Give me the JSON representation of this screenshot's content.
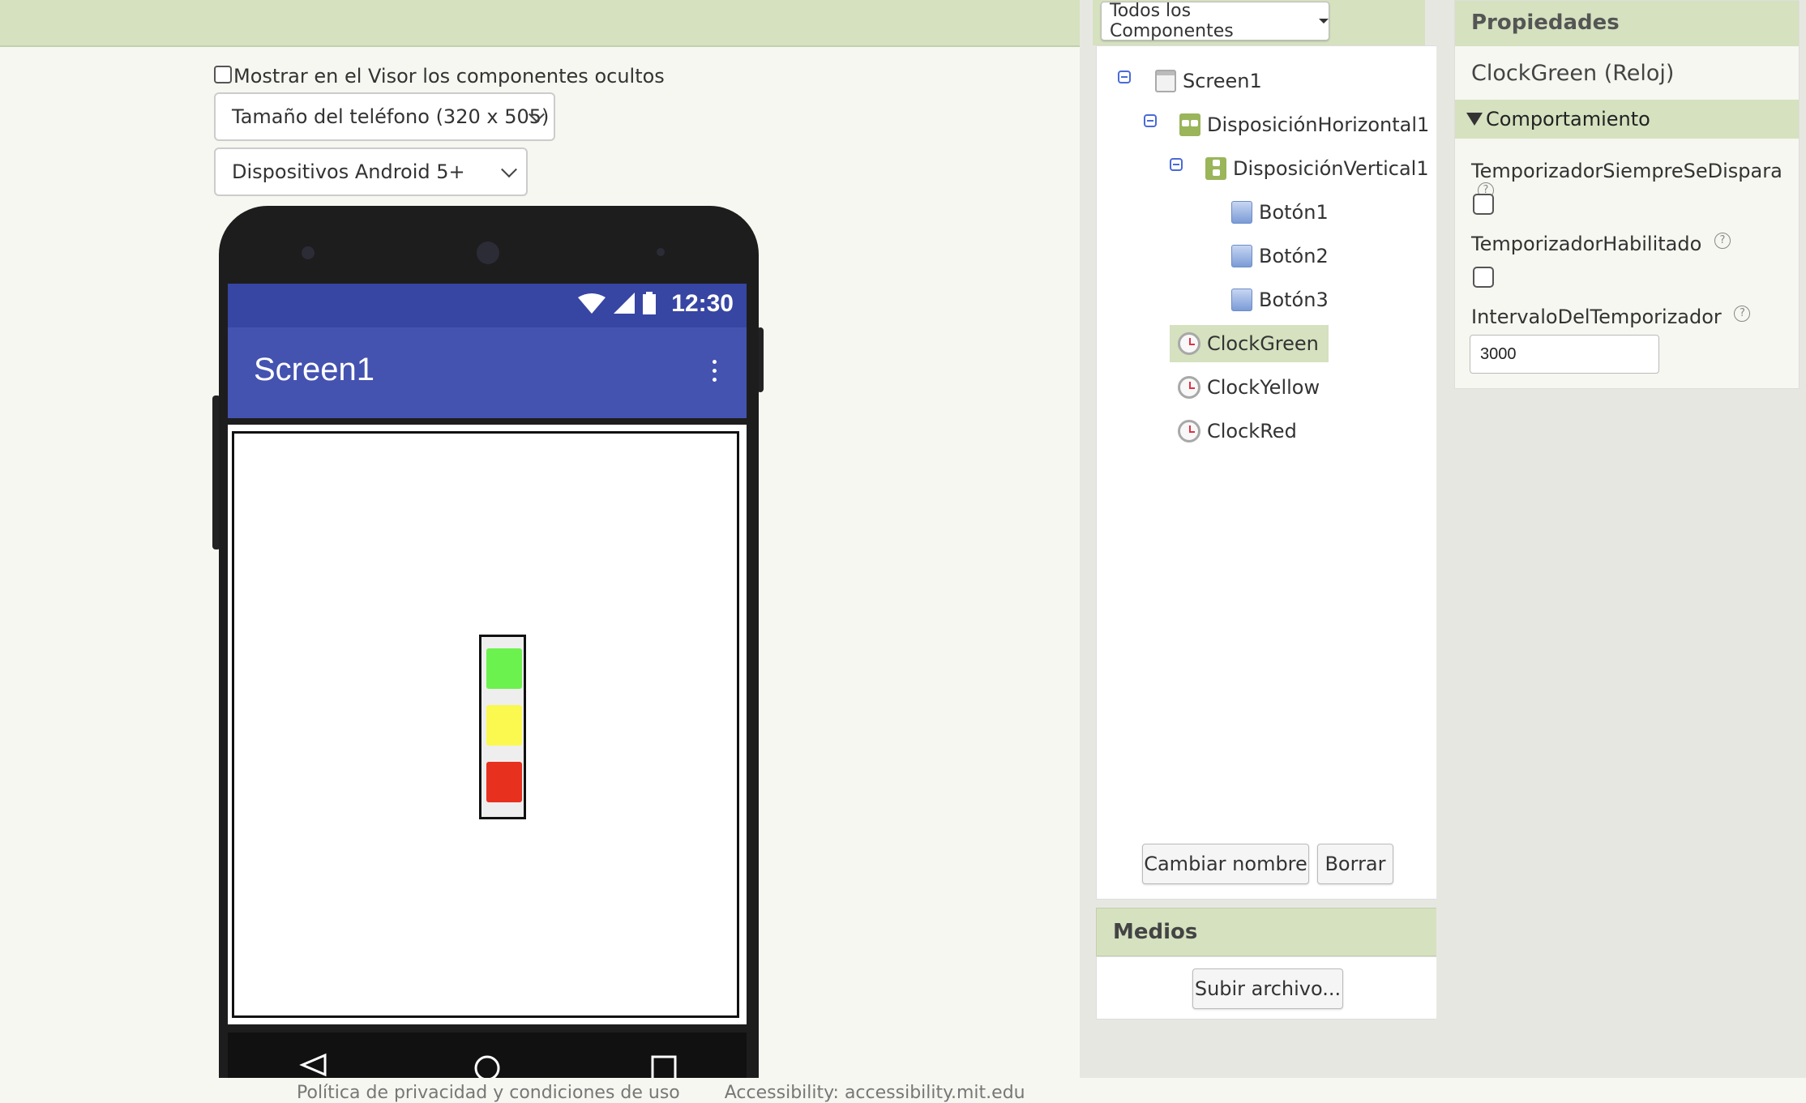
{
  "viewer": {
    "show_hidden_label": "Mostrar en el Visor los componentes ocultos",
    "phone_size": "Tamaño del teléfono (320 x 505)",
    "android_version": "Dispositivos Android 5+"
  },
  "phone": {
    "status_time": "12:30",
    "screen_title": "Screen1",
    "traffic_light_colors": {
      "green": "#6cf24f",
      "yellow": "#fbf84f",
      "red": "#e8301f"
    }
  },
  "components": {
    "dropdown_label": "Todos los Componentes",
    "tree": [
      {
        "label": "Screen1",
        "icon": "screen-icon"
      },
      {
        "label": "DisposiciónHorizontal1",
        "icon": "horizontal-layout-icon"
      },
      {
        "label": "DisposiciónVertical1",
        "icon": "vertical-layout-icon"
      },
      {
        "label": "Botón1",
        "icon": "button-icon"
      },
      {
        "label": "Botón2",
        "icon": "button-icon"
      },
      {
        "label": "Botón3",
        "icon": "button-icon"
      },
      {
        "label": "ClockGreen",
        "icon": "clock-icon",
        "selected": true
      },
      {
        "label": "ClockYellow",
        "icon": "clock-icon"
      },
      {
        "label": "ClockRed",
        "icon": "clock-icon"
      }
    ],
    "rename_button": "Cambiar nombre",
    "delete_button": "Borrar"
  },
  "media": {
    "title": "Medios",
    "upload_button": "Subir archivo..."
  },
  "properties": {
    "title": "Propiedades",
    "component": "ClockGreen (Reloj)",
    "section": "Comportamiento",
    "timer_always_fires_label": "TemporizadorSiempreSeDispara",
    "timer_enabled_label": "TemporizadorHabilitado",
    "timer_interval_label": "IntervaloDelTemporizador",
    "timer_interval_value": "3000",
    "help_glyph": "?"
  },
  "footer": {
    "privacy": "Política de privacidad y condiciones de uso",
    "accessibility": "Accessibility: accessibility.mit.edu"
  },
  "colors": {
    "header_green": "#d5e1bf",
    "app_bar": "#4452b0",
    "status_bar": "#3745a3"
  }
}
